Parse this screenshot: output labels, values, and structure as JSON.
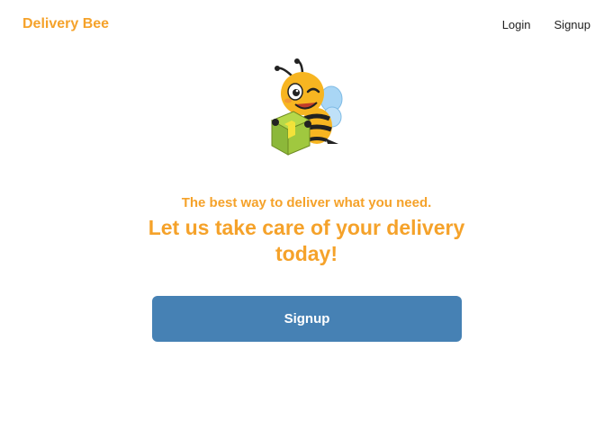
{
  "header": {
    "brand": "Delivery Bee",
    "nav": {
      "login_label": "Login",
      "signup_label": "Signup"
    }
  },
  "hero": {
    "mascot_icon": "bee-carrying-package-icon",
    "tagline": "The best way to deliver what you need.",
    "headline": "Let us take care of your delivery today!",
    "signup_button_label": "Signup"
  },
  "colors": {
    "brand_orange": "#f5a22a",
    "button_blue": "#4681b4",
    "nav_text": "#222222",
    "background": "#ffffff"
  }
}
